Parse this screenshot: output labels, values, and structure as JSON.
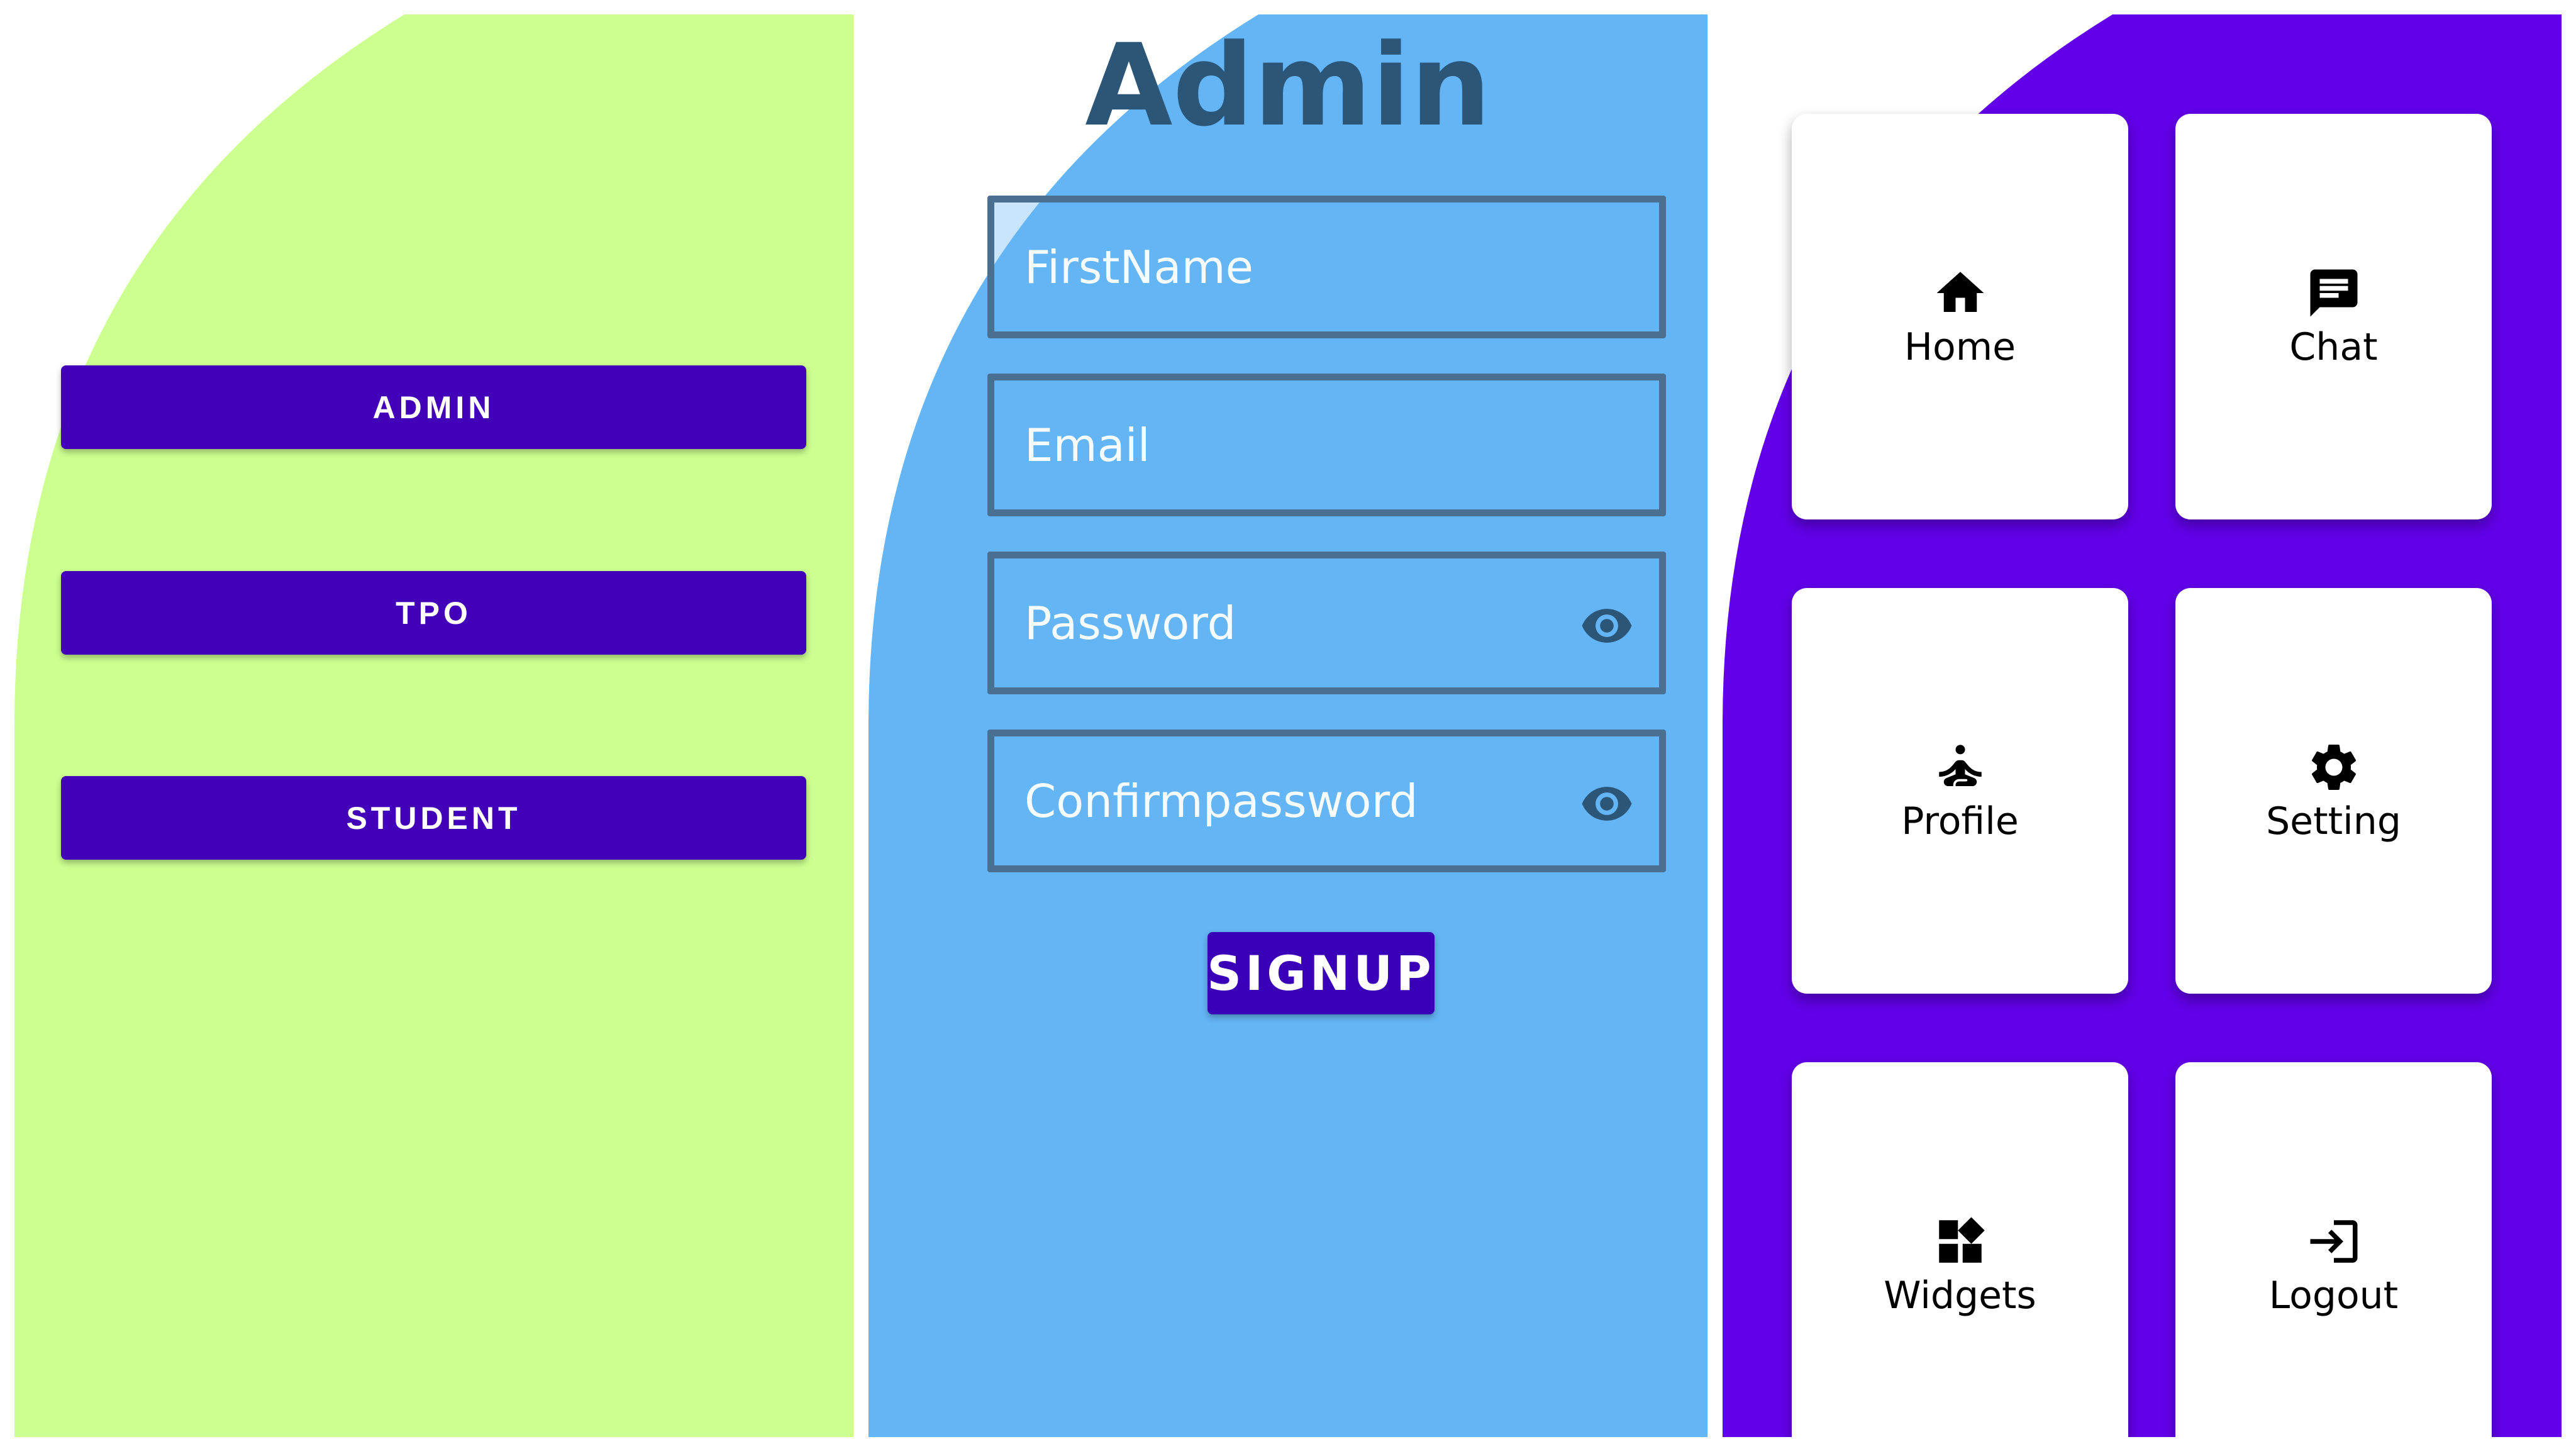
{
  "colors": {
    "left_bg": "#ccff90",
    "mid_bg": "#64b5f6",
    "right_bg": "#6200ea",
    "button": "#4200b8"
  },
  "left_panel": {
    "buttons": [
      {
        "label": "ADMIN"
      },
      {
        "label": "TPO"
      },
      {
        "label": "STUDENT"
      }
    ]
  },
  "signup_form": {
    "title": "Admin",
    "fields": [
      {
        "placeholder": "FirstName",
        "value": ""
      },
      {
        "placeholder": "Email",
        "value": ""
      },
      {
        "placeholder": "Password",
        "value": "",
        "icon": "eye-icon"
      },
      {
        "placeholder": "Confirmpassword",
        "value": "",
        "icon": "eye-icon"
      }
    ],
    "submit_label": "SIGNUP"
  },
  "dashboard": {
    "cards": [
      {
        "label": "Home",
        "icon": "home-icon"
      },
      {
        "label": "Chat",
        "icon": "chat-icon"
      },
      {
        "label": "Profile",
        "icon": "profile-icon"
      },
      {
        "label": "Setting",
        "icon": "settings-icon"
      },
      {
        "label": "Widgets",
        "icon": "widgets-icon"
      },
      {
        "label": "Logout",
        "icon": "logout-icon"
      }
    ]
  }
}
